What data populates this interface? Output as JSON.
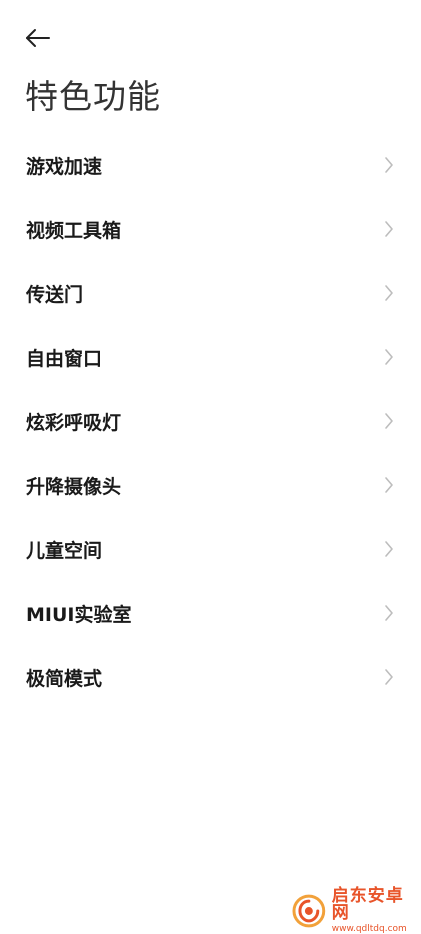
{
  "header": {
    "title": "特色功能"
  },
  "menu": {
    "items": [
      {
        "label": "游戏加速"
      },
      {
        "label": "视频工具箱"
      },
      {
        "label": "传送门"
      },
      {
        "label": "自由窗口"
      },
      {
        "label": "炫彩呼吸灯"
      },
      {
        "label": "升降摄像头"
      },
      {
        "label": "儿童空间"
      },
      {
        "label": "MIUI实验室"
      },
      {
        "label": "极简模式"
      }
    ]
  },
  "watermark": {
    "name": "启东安卓网",
    "url": "www.qdltdq.com"
  },
  "colors": {
    "background": "#ffffff",
    "text": "#1a1a1a",
    "title": "#333333",
    "chevron": "#bdbdbd",
    "watermark": "#e8542a"
  },
  "icons": {
    "back": "arrow-left-icon",
    "chevron": "chevron-right-icon"
  }
}
